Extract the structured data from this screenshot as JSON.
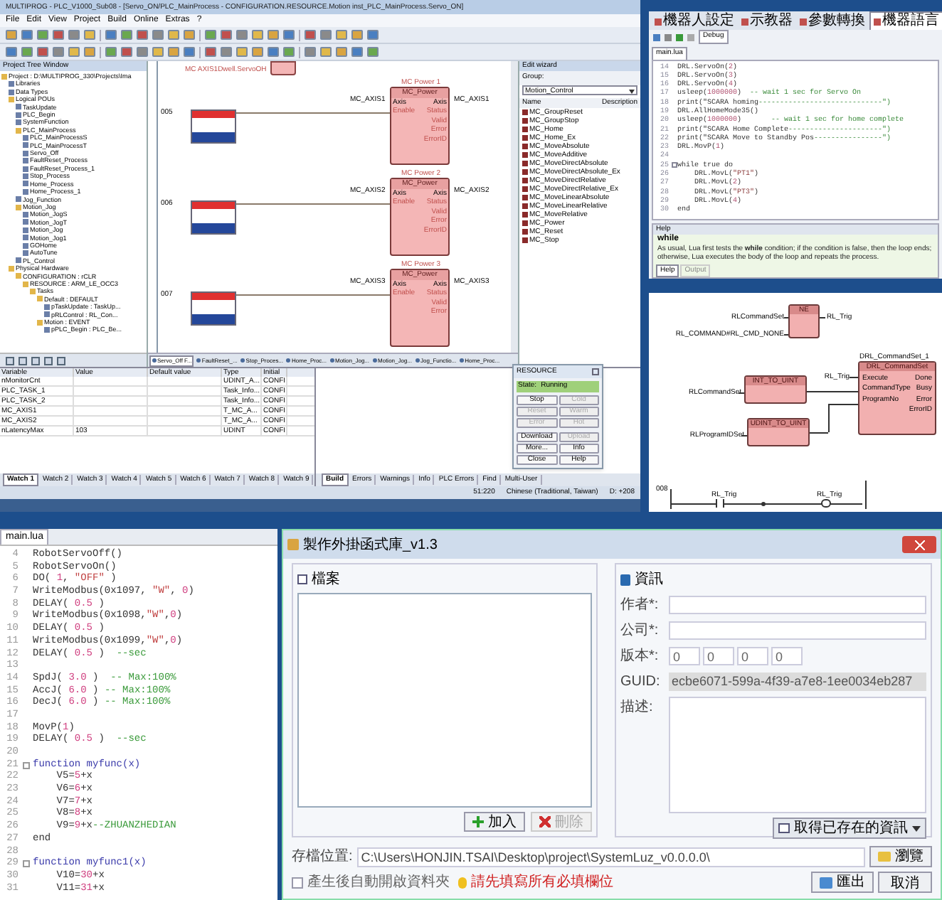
{
  "plc_ide": {
    "title": "MULTIPROG - PLC_V1000_Sub08 - [Servo_ON/PLC_MainProcess - CONFIGURATION.RESOURCE.Motion inst_PLC_MainProcess.Servo_ON]",
    "menu": [
      "File",
      "Edit",
      "View",
      "Project",
      "Build",
      "Online",
      "Extras",
      "?"
    ],
    "project_tree": {
      "title": "Project Tree Window",
      "items": [
        {
          "label": "Project : D:\\MULTIPROG_330\\Projects\\Ima",
          "children": [
            {
              "label": "Libraries"
            },
            {
              "label": "Data Types"
            },
            {
              "label": "Logical POUs",
              "children": [
                {
                  "label": "TaskUpdate"
                },
                {
                  "label": "PLC_Begin"
                },
                {
                  "label": "SystemFunction"
                },
                {
                  "label": "PLC_MainProcess",
                  "children": [
                    {
                      "label": "PLC_MainProcessS"
                    },
                    {
                      "label": "PLC_MainProcessT"
                    },
                    {
                      "label": "Servo_Off"
                    },
                    {
                      "label": "FaultReset_Process"
                    },
                    {
                      "label": "FaultReset_Process_1"
                    },
                    {
                      "label": "Stop_Process"
                    },
                    {
                      "label": "Home_Process"
                    },
                    {
                      "label": "Home_Process_1"
                    }
                  ]
                },
                {
                  "label": "Jog_Function"
                },
                {
                  "label": "Motion_Jog",
                  "children": [
                    {
                      "label": "Motion_JogS"
                    },
                    {
                      "label": "Motion_JogT"
                    },
                    {
                      "label": "Motion_Jog"
                    },
                    {
                      "label": "Motion_Jog1"
                    },
                    {
                      "label": "GOHome"
                    },
                    {
                      "label": "AutoTune"
                    }
                  ]
                },
                {
                  "label": "PL_Control"
                }
              ]
            },
            {
              "label": "Physical Hardware",
              "children": [
                {
                  "label": "CONFIGURATION : rCLR",
                  "children": [
                    {
                      "label": "RESOURCE : ARM_LE_OCC3",
                      "children": [
                        {
                          "label": "Tasks",
                          "children": [
                            {
                              "label": "Default : DEFAULT",
                              "children": [
                                {
                                  "label": "pTaskUpdate : TaskUp..."
                                },
                                {
                                  "label": "pRLControl : RL_Con..."
                                }
                              ]
                            },
                            {
                              "label": "Motion : EVENT",
                              "children": [
                                {
                                  "label": "pPLC_Begin : PLC_Be..."
                                }
                              ]
                            }
                          ]
                        }
                      ]
                    }
                  ]
                }
              ]
            }
          ]
        }
      ]
    },
    "canvas": {
      "top_label": "MC AXIS1Dwell.ServoOH",
      "rungs": [
        "005",
        "006",
        "007"
      ],
      "blocks": [
        {
          "instance": "MC Power 1",
          "type": "MC_Power",
          "axis_in": "MC_AXIS1",
          "axis_out": "MC_AXIS1",
          "inputs": [
            "Axis",
            "Enable"
          ],
          "outputs": [
            "Axis",
            "Status",
            "Valid",
            "Error",
            "ErrorID"
          ]
        },
        {
          "instance": "MC Power 2",
          "type": "MC_Power",
          "axis_in": "MC_AXIS2",
          "axis_out": "MC_AXIS2",
          "inputs": [
            "Axis",
            "Enable"
          ],
          "outputs": [
            "Axis",
            "Status",
            "Valid",
            "Error",
            "ErrorID"
          ]
        },
        {
          "instance": "MC Power 3",
          "type": "MC_Power",
          "axis_in": "MC_AXIS3",
          "axis_out": "MC_AXIS3",
          "inputs": [
            "Axis",
            "Enable"
          ],
          "outputs": [
            "Axis",
            "Status",
            "Valid",
            "Error"
          ]
        }
      ]
    },
    "library": {
      "title": "Edit wizard",
      "group_label": "Group:",
      "group_value": "Motion_Control",
      "columns": [
        "Name",
        "Description"
      ],
      "items": [
        "MC_GroupReset",
        "MC_GroupStop",
        "MC_Home",
        "MC_Home_Ex",
        "MC_MoveAbsolute",
        "MC_MoveAdditive",
        "MC_MoveDirectAbsolute",
        "MC_MoveDirectAbsolute_Ex",
        "MC_MoveDirectRelative",
        "MC_MoveDirectRelative_Ex",
        "MC_MoveLinearAbsolute",
        "MC_MoveLinearRelative",
        "MC_MoveRelative",
        "MC_Power",
        "MC_Reset",
        "MC_Stop"
      ]
    },
    "editor_tabs": [
      {
        "label": "Servo_Off F...",
        "selected": true
      },
      {
        "label": "FaultReset_...",
        "selected": false
      },
      {
        "label": "Stop_Proces...",
        "selected": false
      },
      {
        "label": "Home_Proc...",
        "selected": false
      },
      {
        "label": "Motion_Jog...",
        "selected": false
      },
      {
        "label": "Motion_Jog...",
        "selected": false
      },
      {
        "label": "Jog_Functio...",
        "selected": false
      },
      {
        "label": "Home_Proc...",
        "selected": false
      }
    ],
    "watch": {
      "columns": [
        "Variable",
        "Value",
        "Default value",
        "Type",
        "Initial"
      ],
      "rows": [
        [
          "nMonitorCnt",
          "",
          "",
          "UDINT_A...",
          "CONFI"
        ],
        [
          "PLC_TASK_1",
          "",
          "",
          "Task_Info...",
          "CONFI"
        ],
        [
          "PLC_TASK_2",
          "",
          "",
          "Task_Info...",
          "CONFI"
        ],
        [
          "MC_AXIS1",
          "",
          "",
          "T_MC_A...",
          "CONFI"
        ],
        [
          "MC_AXIS2",
          "",
          "",
          "T_MC_A...",
          "CONFI"
        ],
        [
          "nLatencyMax",
          "103",
          "",
          "UDINT",
          "CONFI"
        ]
      ]
    },
    "watch_tabs": [
      {
        "label": "Watch 1",
        "selected": true
      },
      {
        "label": "Watch 2",
        "selected": false
      },
      {
        "label": "Watch 3",
        "selected": false
      },
      {
        "label": "Watch 4",
        "selected": false
      },
      {
        "label": "Watch 5",
        "selected": false
      },
      {
        "label": "Watch 6",
        "selected": false
      },
      {
        "label": "Watch 7",
        "selected": false
      },
      {
        "label": "Watch 8",
        "selected": false
      },
      {
        "label": "Watch 9",
        "selected": false
      }
    ],
    "message_tabs": [
      {
        "label": "Build",
        "selected": true
      },
      {
        "label": "Errors",
        "selected": false
      },
      {
        "label": "Warnings",
        "selected": false
      },
      {
        "label": "Info",
        "selected": false
      },
      {
        "label": "PLC Errors",
        "selected": false
      },
      {
        "label": "Find",
        "selected": false
      },
      {
        "label": "Multi-User",
        "selected": false
      }
    ],
    "resource": {
      "title": "RESOURCE",
      "state_label": "State:",
      "state_value": "Running",
      "buttons": [
        {
          "label": "Stop",
          "disabled": false
        },
        {
          "label": "Cold",
          "disabled": true
        },
        {
          "label": "Reset",
          "disabled": true
        },
        {
          "label": "Warm",
          "disabled": true
        },
        {
          "label": "Error",
          "disabled": true
        },
        {
          "label": "Hot",
          "disabled": true
        },
        {
          "label": "Download",
          "disabled": false
        },
        {
          "label": "Upload",
          "disabled": true
        },
        {
          "label": "More...",
          "disabled": false
        },
        {
          "label": "Info",
          "disabled": false
        },
        {
          "label": "Close",
          "disabled": false
        },
        {
          "label": "Help",
          "disabled": false
        }
      ]
    },
    "status_bar": [
      "51:220",
      "Chinese (Traditional, Taiwan)",
      "D: +208"
    ]
  },
  "lua_ide": {
    "tabs": [
      {
        "label": "機器人設定",
        "selected": false
      },
      {
        "label": "示教器",
        "selected": false
      },
      {
        "label": "參數轉換",
        "selected": false
      },
      {
        "label": "機器語言",
        "selected": true
      }
    ],
    "mode": "Debug",
    "file_tab": "main.lua",
    "lines": [
      {
        "no": "14",
        "text": "DRL.ServoOn(2)"
      },
      {
        "no": "15",
        "text": "DRL.ServoOn(3)"
      },
      {
        "no": "16",
        "text": "DRL.ServoOn(4)"
      },
      {
        "no": "17",
        "text": "usleep(1000000)  -- wait 1 sec for Servo On"
      },
      {
        "no": "18",
        "text": "print(\"SCARA homing-----------------------------\")"
      },
      {
        "no": "19",
        "text": "DRL.AllHomeMode35()"
      },
      {
        "no": "20",
        "text": "usleep(1000000)       -- wait 1 sec for home complete"
      },
      {
        "no": "21",
        "text": "print(\"SCARA Home Complete----------------------\")"
      },
      {
        "no": "22",
        "text": "print(\"SCARA Move to Standby Pos----------------\")"
      },
      {
        "no": "23",
        "text": "DRL.MovP(1)"
      },
      {
        "no": "24"
      },
      {
        "no": "25",
        "text": "while true do",
        "fold": true
      },
      {
        "no": "26",
        "text": "    DRL.MovL(\"PT1\")"
      },
      {
        "no": "27",
        "text": "    DRL.MovL(2)"
      },
      {
        "no": "28",
        "text": "    DRL.MovL(\"PT3\")"
      },
      {
        "no": "29",
        "text": "    DRL.MovL(4)"
      },
      {
        "no": "30",
        "text": "end"
      }
    ],
    "help": {
      "title": "Help",
      "keyword": "while",
      "text": "As usual, Lua first tests the **while** condition; if the condition is false, then the loop ends; otherwise, Lua executes the body of the loop and repeats the process.",
      "tabs": [
        {
          "label": "Help",
          "selected": true
        },
        {
          "label": "Output",
          "selected": false
        }
      ]
    }
  },
  "fbd": {
    "compare": {
      "type": "NE",
      "inputs": [
        "RLCommandSet",
        "RL_COMMAND#RL_CMD_NONE"
      ],
      "output": "RL_Trig"
    },
    "converters": [
      {
        "type": "INT_TO_UINT",
        "input": "RLCommandSet"
      },
      {
        "type": "UDINT_TO_UINT",
        "input": "RLProgramIDSet"
      }
    ],
    "command": {
      "instance": "DRL_CommandSet_1",
      "type": "DRL_CommandSet",
      "trigger": "RL_Trig",
      "inputs": [
        "Execute",
        "CommandType",
        "ProgramNo"
      ],
      "outputs": [
        "Done",
        "Busy",
        "Error",
        "ErrorID"
      ]
    },
    "rung": {
      "number": "008",
      "contact": "RL_Trig",
      "coil": "RL_Trig"
    }
  },
  "code_editor": {
    "file_tab": "main.lua",
    "lines": [
      {
        "no": "4",
        "text": "RobotServoOff()"
      },
      {
        "no": "5",
        "text": "RobotServoOn()"
      },
      {
        "no": "6",
        "text": "DO( 1, \"OFF\" )"
      },
      {
        "no": "7",
        "text": "WriteModbus(0x1097, \"W\", 0)"
      },
      {
        "no": "8",
        "text": "DELAY( 0.5 )"
      },
      {
        "no": "9",
        "text": "WriteModbus(0x1098,\"W\",0)"
      },
      {
        "no": "10",
        "text": "DELAY( 0.5 )"
      },
      {
        "no": "11",
        "text": "WriteModbus(0x1099,\"W\",0)"
      },
      {
        "no": "12",
        "text": "DELAY( 0.5 )  --sec"
      },
      {
        "no": "13"
      },
      {
        "no": "14",
        "text": "SpdJ( 3.0 )  -- Max:100%"
      },
      {
        "no": "15",
        "text": "AccJ( 6.0 ) -- Max:100%"
      },
      {
        "no": "16",
        "text": "DecJ( 6.0 ) -- Max:100%"
      },
      {
        "no": "17"
      },
      {
        "no": "18",
        "text": "MovP(1)"
      },
      {
        "no": "19",
        "text": "DELAY( 0.5 )  --sec"
      },
      {
        "no": "20"
      },
      {
        "no": "21",
        "text": "function myfunc(x)",
        "fold": true
      },
      {
        "no": "22",
        "text": "    V5=5+x"
      },
      {
        "no": "23",
        "text": "    V6=6+x"
      },
      {
        "no": "24",
        "text": "    V7=7+x"
      },
      {
        "no": "25",
        "text": "    V8=8+x"
      },
      {
        "no": "26",
        "text": "    V9=9+x--ZHUANZHEDIAN"
      },
      {
        "no": "27",
        "text": "end"
      },
      {
        "no": "28"
      },
      {
        "no": "29",
        "text": "function myfunc1(x)",
        "fold": true
      },
      {
        "no": "30",
        "text": "    V10=30+x"
      },
      {
        "no": "31",
        "text": "    V11=31+x"
      }
    ]
  },
  "dialog": {
    "title": "製作外掛函式庫_v1.3",
    "files_label": "檔案",
    "add": "加入",
    "delete": "刪除",
    "info_label": "資訊",
    "author_label": "作者*:",
    "company_label": "公司*:",
    "version_label": "版本*:",
    "version": [
      "0",
      "0",
      "0",
      "0"
    ],
    "guid_label": "GUID:",
    "guid": "ecbe6071-599a-4f39-a7e8-1ee0034eb287",
    "description_label": "描述:",
    "fetch": "取得已存在的資訊",
    "path_label": "存檔位置:",
    "path": "C:\\Users\\HONJIN.TSAI\\Desktop\\project\\SystemLuz_v0.0.0.0\\",
    "browse": "瀏覽",
    "open_after": {
      "label": "產生後自動開啟資料夾",
      "checked": false
    },
    "warning": "請先填寫所有必填欄位",
    "export": "匯出",
    "cancel": "取消"
  }
}
